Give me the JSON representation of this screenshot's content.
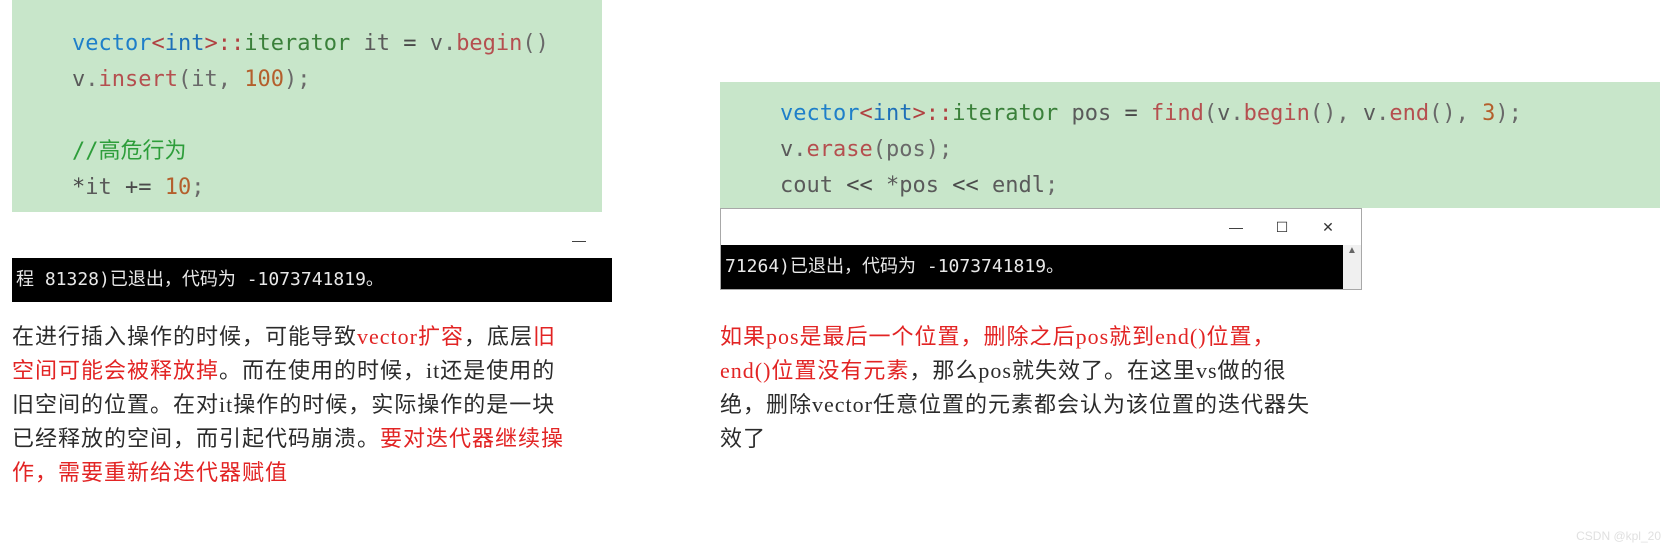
{
  "left": {
    "code": {
      "l1": {
        "vector": "vector",
        "lt": "<",
        "int": "int",
        "gt": ">",
        "scope": "::",
        "iterator": "iterator",
        "sp_it": " it ",
        "eq": "= ",
        "v": "v",
        "dot1": ".",
        "begin": "begin",
        "paren1": "()"
      },
      "l2": {
        "v": "v",
        "dot": ".",
        "insert": "insert",
        "args": "(it, ",
        "num": "100",
        "close": ");"
      },
      "l4": {
        "comment": "//高危行为"
      },
      "l5": {
        "star": "*",
        "it": "it ",
        "peq": "+= ",
        "ten": "10",
        "semi": ";"
      }
    },
    "win_minimize": "—",
    "console": "程 81328)已退出，代码为 -1073741819。",
    "explain": {
      "p1a": "在进行插入操作的时候，可能导致",
      "p1b": "vector扩容",
      "p1c": "，底层",
      "p1d": "旧空间可能会被释放掉",
      "p1e": "。而在使用的时候，it还是使用的旧空间的位置。在对it操作的时候，实际操作的是一块已经释放的空间，而引起代码崩溃。",
      "p1f": "要对迭代器继续操作，需要重新给迭代器赋值"
    }
  },
  "right": {
    "code": {
      "l1": {
        "vector": "vector",
        "lt": "<",
        "int": "int",
        "gt": ">",
        "scope": "::",
        "iterator": "iterator",
        "sp_pos": " pos ",
        "eq": "= ",
        "find": "find",
        "open": "(",
        "v1": "v",
        "dot1": ".",
        "begin": "begin",
        "p1": "(), ",
        "v2": "v",
        "dot2": ".",
        "end": "end",
        "p2": "(), ",
        "three": "3",
        "close": ");"
      },
      "l2": {
        "v": "v",
        "dot": ".",
        "erase": "erase",
        "args": "(pos);"
      },
      "l3": {
        "cout": "cout ",
        "ll1": "<< ",
        "starpos": "*pos ",
        "ll2": "<< ",
        "endl": "endl",
        "semi": ";"
      }
    },
    "win_minimize": "—",
    "win_maximize": "☐",
    "win_close": "✕",
    "scroll_up": "▲",
    "console": "71264)已退出，代码为 -1073741819。",
    "explain": {
      "p1a": "如果pos是最后一个位置，删除之后pos就到end()位置，end()位置没有元素",
      "p1b": "，那么pos就失效了。在这里vs做的很绝，删除vector任意位置的元素都会认为该位置的迭代器失效了"
    }
  },
  "watermark": "CSDN @kpl_20"
}
